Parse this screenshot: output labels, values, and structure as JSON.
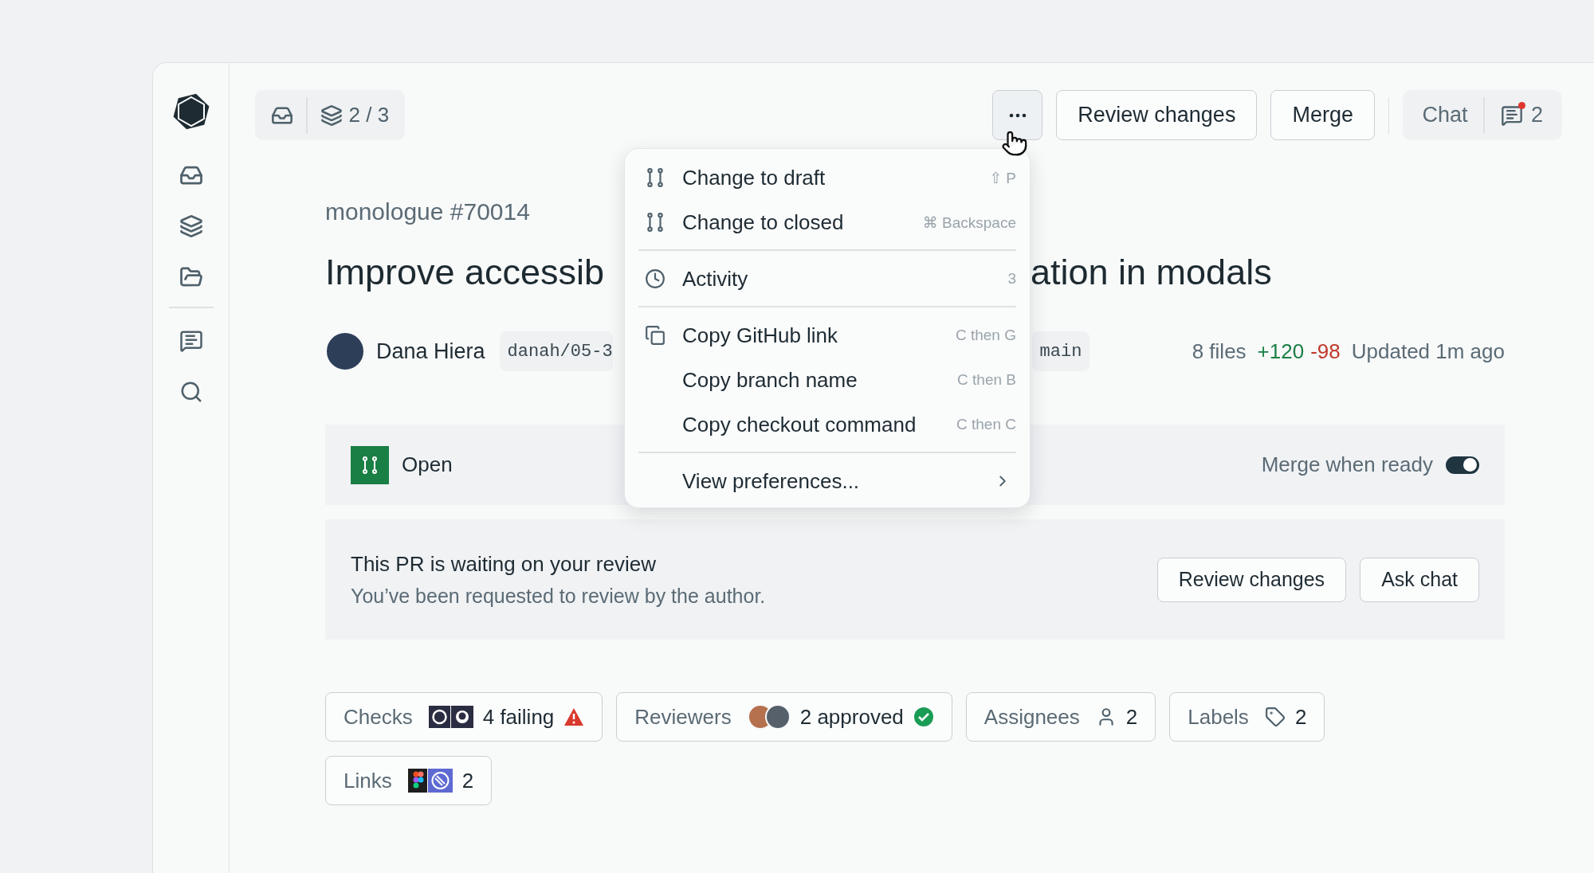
{
  "toolbar": {
    "stack_position": "2 / 3",
    "buttons": [
      "Review changes",
      "Merge"
    ],
    "chat": {
      "label": "Chat",
      "count": "2",
      "unread": true
    }
  },
  "pr": {
    "repo_number": "monologue #70014",
    "title_parts": [
      "Improve accessib",
      "ation in modals"
    ],
    "author": "Dana Hiera",
    "head_branch": "danah/05-3",
    "base_branch": "main",
    "files": "8 files",
    "additions": "+120",
    "deletions": "-98",
    "updated": "Updated 1m ago"
  },
  "menu": {
    "groups": [
      [
        {
          "kind": "state",
          "label": "Change to draft",
          "shortcut": "⇧ P"
        },
        {
          "kind": "state",
          "label": "Change to closed",
          "shortcut": "⌘ Backspace"
        }
      ],
      [
        {
          "kind": "history",
          "label": "Activity",
          "shortcut": "3"
        }
      ],
      [
        {
          "kind": "copy",
          "label": "Copy GitHub link",
          "shortcut": "C then G"
        },
        {
          "kind": "plain",
          "label": "Copy branch name",
          "shortcut": "C then B"
        },
        {
          "kind": "plain",
          "label": "Copy checkout command",
          "shortcut": "C then C"
        }
      ],
      [
        {
          "kind": "submenu",
          "label": "View preferences..."
        }
      ]
    ]
  },
  "status": {
    "kind": "open",
    "label": "Open",
    "merge_when_ready_label": "Merge when ready",
    "merge_when_ready": true
  },
  "review": {
    "title": "This PR is waiting on your review",
    "message": "You’ve been requested to review by the author.",
    "buttons": [
      "Review changes",
      "Ask chat"
    ]
  },
  "chips": [
    {
      "kind": "checks",
      "label": "Checks",
      "value": "4 failing"
    },
    {
      "kind": "reviewers",
      "label": "Reviewers",
      "value": "2 approved"
    },
    {
      "kind": "assignees",
      "label": "Assignees",
      "value": "2"
    },
    {
      "kind": "labels",
      "label": "Labels",
      "value": "2"
    },
    {
      "kind": "links",
      "label": "Links",
      "value": "2"
    }
  ]
}
